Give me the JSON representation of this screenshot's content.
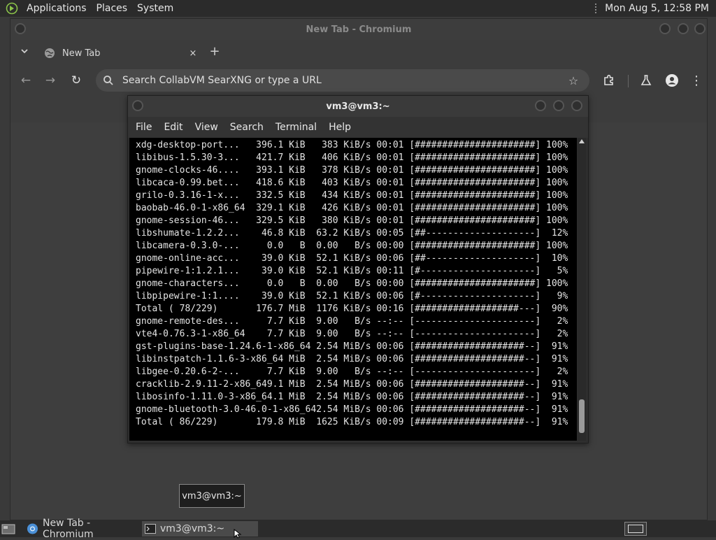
{
  "top_panel": {
    "menus": [
      "Applications",
      "Places",
      "System"
    ],
    "clock": "Mon Aug  5, 12:58 PM"
  },
  "chromium": {
    "window_title": "New Tab - Chromium",
    "tab": {
      "label": "New Tab",
      "close": "×"
    },
    "new_tab": "+",
    "tab_list": "⌄",
    "omnibox_placeholder": "Search CollabVM SearXNG or type a URL",
    "nav": {
      "back": "←",
      "forward": "→",
      "reload": "↻"
    },
    "star": "☆",
    "menu": "⋮"
  },
  "terminal": {
    "title": "vm3@vm3:~",
    "menus": [
      "File",
      "Edit",
      "View",
      "Search",
      "Terminal",
      "Help"
    ],
    "lines": [
      "xdg-desktop-port...   396.1 KiB   383 KiB/s 00:01 [######################] 100%",
      "libibus-1.5.30-3...   421.7 KiB   406 KiB/s 00:01 [######################] 100%",
      "gnome-clocks-46....   393.1 KiB   378 KiB/s 00:01 [######################] 100%",
      "libcaca-0.99.bet...   418.6 KiB   403 KiB/s 00:01 [######################] 100%",
      "grilo-0.3.16-1-x...   332.5 KiB   434 KiB/s 00:01 [######################] 100%",
      "baobab-46.0-1-x86_64  329.1 KiB   426 KiB/s 00:01 [######################] 100%",
      "gnome-session-46...   329.5 KiB   380 KiB/s 00:01 [######################] 100%",
      "libshumate-1.2.2...    46.8 KiB  63.2 KiB/s 00:05 [##--------------------]  12%",
      "libcamera-0.3.0-...     0.0   B  0.00   B/s 00:00 [######################] 100%",
      "gnome-online-acc...    39.0 KiB  52.1 KiB/s 00:06 [##--------------------]  10%",
      "pipewire-1:1.2.1...    39.0 KiB  52.1 KiB/s 00:11 [#---------------------]   5%",
      "gnome-characters...     0.0   B  0.00   B/s 00:00 [######################] 100%",
      "libpipewire-1:1....    39.0 KiB  52.1 KiB/s 00:06 [#---------------------]   9%",
      "Total ( 78/229)       176.7 MiB  1176 KiB/s 00:16 [###################---]  90%",
      "gnome-remote-des...     7.7 KiB  9.00   B/s --:-- [----------------------]   2%",
      "vte4-0.76.3-1-x86_64    7.7 KiB  9.00   B/s --:-- [----------------------]   2%",
      "gst-plugins-base-1.24.6-1-x86_64 2.54 MiB/s 00:06 [####################--]  91%",
      "libinstpatch-1.1.6-3-x86_64 MiB  2.54 MiB/s 00:06 [####################--]  91%",
      "libgee-0.20.6-2-...     7.7 KiB  9.00   B/s --:-- [----------------------]   2%",
      "cracklib-2.9.11-2-x86_649.1 MiB  2.54 MiB/s 00:06 [####################--]  91%",
      "libosinfo-1.11.0-3-x86_64.1 MiB  2.54 MiB/s 00:06 [####################--]  91%",
      "gnome-bluetooth-3.0-46.0-1-x86_642.54 MiB/s 00:06 [####################--]  91%",
      "Total ( 86/229)       179.8 MiB  1625 KiB/s 00:09 [####################--]  91%"
    ]
  },
  "tooltip": "vm3@vm3:~",
  "taskbar": {
    "tasks": [
      {
        "label": "New Tab - Chromium",
        "icon": "chromium-icon"
      },
      {
        "label": "vm3@vm3:~",
        "icon": "terminal-icon"
      }
    ]
  }
}
